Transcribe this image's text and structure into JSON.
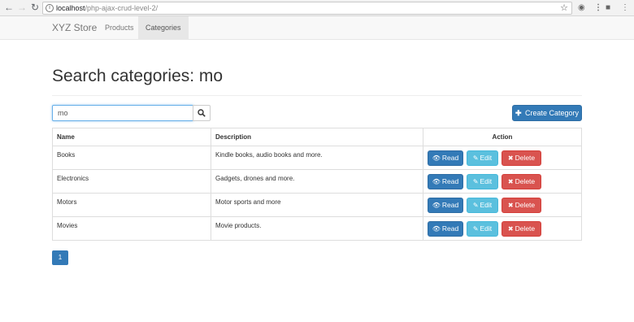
{
  "browser": {
    "url_host": "localhost",
    "url_path": "/php-ajax-crud-level-2/"
  },
  "navbar": {
    "brand": "XYZ Store",
    "items": [
      {
        "label": "Products",
        "active": false
      },
      {
        "label": "Categories",
        "active": true
      }
    ]
  },
  "page": {
    "title": "Search categories: mo"
  },
  "search": {
    "value": "mo"
  },
  "toolbar": {
    "create_label": "Create Category"
  },
  "table": {
    "headers": {
      "name": "Name",
      "description": "Description",
      "action": "Action"
    },
    "rows": [
      {
        "name": "Books",
        "description": "Kindle books, audio books and more."
      },
      {
        "name": "Electronics",
        "description": "Gadgets, drones and more."
      },
      {
        "name": "Motors",
        "description": "Motor sports and more"
      },
      {
        "name": "Movies",
        "description": "Movie products."
      }
    ],
    "row_actions": {
      "read": "Read",
      "edit": "Edit",
      "delete": "Delete"
    }
  },
  "pagination": {
    "current": "1"
  },
  "colors": {
    "primary": "#337ab7",
    "info": "#5bc0de",
    "danger": "#d9534f",
    "navbar_bg": "#f8f8f8"
  }
}
